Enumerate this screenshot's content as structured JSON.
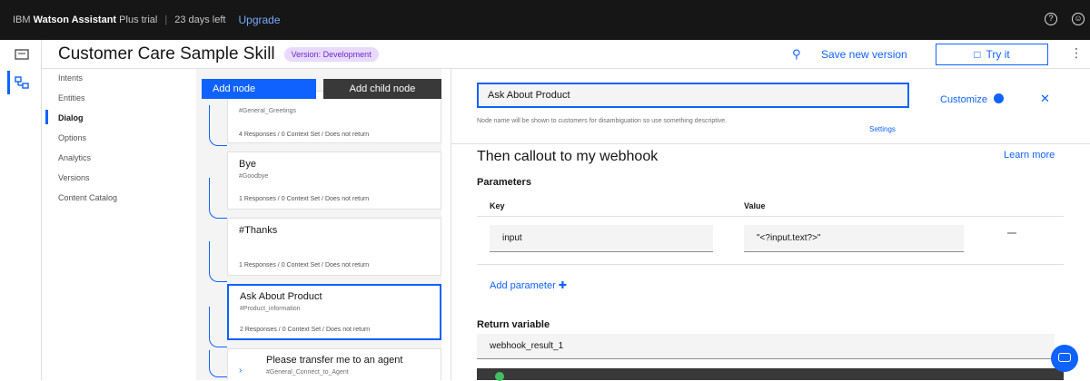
{
  "topbar": {
    "brand_prefix": "IBM",
    "brand_name": "Watson Assistant",
    "plan": "Plus trial",
    "days_left": "23 days left",
    "upgrade": "Upgrade",
    "icons": [
      "help-icon",
      "account-icon"
    ]
  },
  "rail": {
    "icons": [
      "assistants-icon",
      "skills-icon"
    ]
  },
  "header": {
    "title": "Customer Care Sample Skill",
    "version_badge": "Version: Development",
    "save_label": "Save new version",
    "try_label": "Try it"
  },
  "nav": {
    "items": [
      {
        "label": "Intents",
        "active": false
      },
      {
        "label": "Entities",
        "active": false
      },
      {
        "label": "Dialog",
        "active": true
      },
      {
        "label": "Options",
        "active": false
      },
      {
        "label": "Analytics",
        "active": false
      },
      {
        "label": "Versions",
        "active": false
      },
      {
        "label": "Content Catalog",
        "active": false
      }
    ]
  },
  "tree": {
    "add_node": "Add node",
    "add_child_node": "Add child node",
    "nodes": [
      {
        "title": "",
        "condition": "#General_Greetings",
        "footer": "4 Responses / 0 Context Set / Does not return"
      },
      {
        "title": "Bye",
        "condition": "#Goodbye",
        "footer": "1 Responses / 0 Context Set / Does not return"
      },
      {
        "title": "#Thanks",
        "condition": "",
        "footer": "1 Responses / 0 Context Set / Does not return"
      },
      {
        "title": "Ask About Product",
        "condition": "#Product_information",
        "footer": "2 Responses / 0 Context Set / Does not return"
      },
      {
        "title": "Please transfer me to an agent",
        "condition": "#General_Connect_to_Agent",
        "footer": ""
      }
    ]
  },
  "panel": {
    "node_name": "Ask About Product",
    "helper": "Node name will be shown to customers for disambiguation so use something descriptive.",
    "settings": "Settings",
    "customize": "Customize",
    "section_title": "Then callout to my webhook",
    "learn_more": "Learn more",
    "parameters": "Parameters",
    "col_key": "Key",
    "col_value": "Value",
    "param_key": "input",
    "param_value": "\"<?input.text?>\"",
    "add_parameter": "Add parameter",
    "return_label": "Return variable",
    "return_value": "webhook_result_1"
  },
  "colors": {
    "accent": "#0f62fe",
    "topbar": "#161616",
    "badge_bg": "#e8daff",
    "badge_fg": "#6929c4"
  }
}
